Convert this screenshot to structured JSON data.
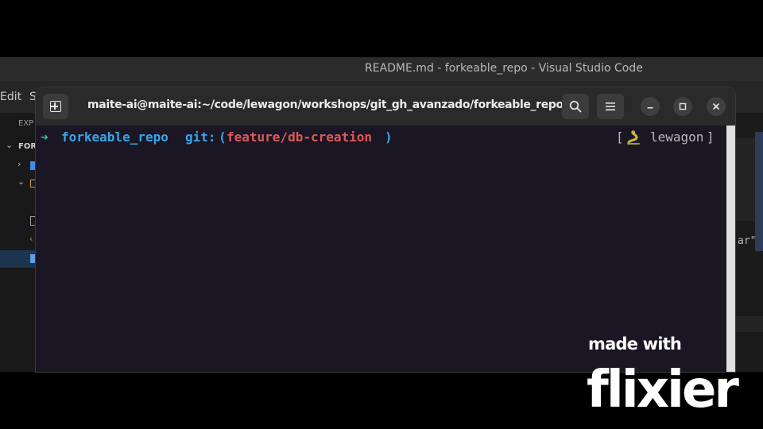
{
  "vscode": {
    "window_title": "README.md - forkeable_repo - Visual Studio Code",
    "menu": [
      "Edit",
      "S"
    ],
    "explorer_header": "EXP",
    "folder_label": "FOR",
    "editor_peek_text": "ar\""
  },
  "terminal": {
    "title": "maite-ai@maite-ai:~/code/lewagon/workshops/git_gh_avanzado/forkeable_repo",
    "prompt": {
      "arrow": "➜",
      "directory": "forkeable_repo",
      "git_label": "git:",
      "paren_open": "(",
      "branch": "feature/db-creation",
      "paren_close": ")"
    },
    "env": {
      "open": "[",
      "name": "lewagon",
      "close": "]",
      "icon": "python-icon"
    },
    "icons": {
      "new_tab": "new-tab-icon",
      "search": "search-icon",
      "menu": "hamburger-menu-icon",
      "minimize": "minimize-icon",
      "maximize": "maximize-icon",
      "close": "close-icon"
    },
    "colors": {
      "background": "#1a1623",
      "header": "#2a2a2a",
      "directory": "#34a7ec",
      "branch": "#e25858",
      "arrow": "#2bc79a"
    }
  },
  "watermark": {
    "line1": "made with",
    "brand": "flixier"
  }
}
